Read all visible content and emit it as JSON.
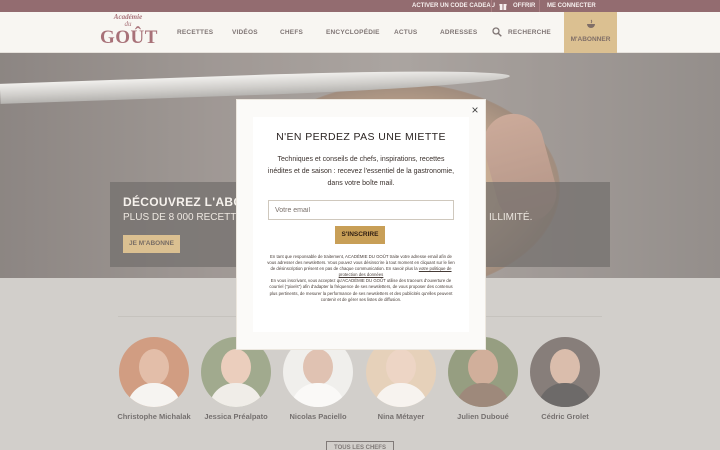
{
  "topbar": {
    "gift_code": "ACTIVER UN CODE CADEAU",
    "offer": "OFFRIR",
    "login": "ME CONNECTER"
  },
  "logo": {
    "line1": "Académie",
    "line2": "du",
    "line3": "GOÛT"
  },
  "nav": {
    "items": [
      "RECETTES",
      "VIDÉOS",
      "CHEFS",
      "ENCYCLOPÉDIE",
      "ACTUS",
      "ADRESSES"
    ],
    "search": "RECHERCHE",
    "subscribe": "M'ABONNER"
  },
  "hero": {
    "title": "DÉCOUVREZ L'ABONNEI",
    "subtitle_left": "PLUS DE 8 000 RECETTES DE",
    "subtitle_right": "N ILLIMITÉ.",
    "button": "JE M'ABONNE"
  },
  "chefs": {
    "names": [
      "Christophe Michalak",
      "Jessica Préalpato",
      "Nicolas Paciello",
      "Nina Métayer",
      "Julien Duboué",
      "Cédric Grolet"
    ],
    "all_button": "TOUS LES CHEFS"
  },
  "modal": {
    "close": "×",
    "title": "N'EN PERDEZ PAS UNE MIETTE",
    "description": "Techniques et conseils de chefs, inspirations, recettes inédites et de saison : recevez l'essentiel de la gastronomie, dans votre boîte mail.",
    "email_placeholder": "Votre email",
    "submit": "S'INSCRIRE",
    "legal_p1_before": "En tant que responsable de traitement, ACADÉMIE DU GOÛT traite votre adresse email afin de vous adresser des newsletters. Vous pouvez vous désinscrire à tout moment en cliquant sur le lien de désinscription présent en pas de chaque communication. En savoir plus la ",
    "legal_link": "votre politique de protection des données",
    "legal_p2": "En vous inscrivant, vous acceptez qu'ACADÉMIE DU GOÛT utilise des traceurs d'ouverture de courriel (\"pixels\") afin d'adapter la fréquence de ses newsletters, de vous proposer des contenus plus pertinents, de mesurer la performance de ses newsletters et des publicités qu'elles peuvent contenir et de gérer ses listes de diffusion."
  },
  "colors": {
    "topbar": "#5a1e24",
    "brand": "#7a2630",
    "accent": "#c89f57"
  }
}
